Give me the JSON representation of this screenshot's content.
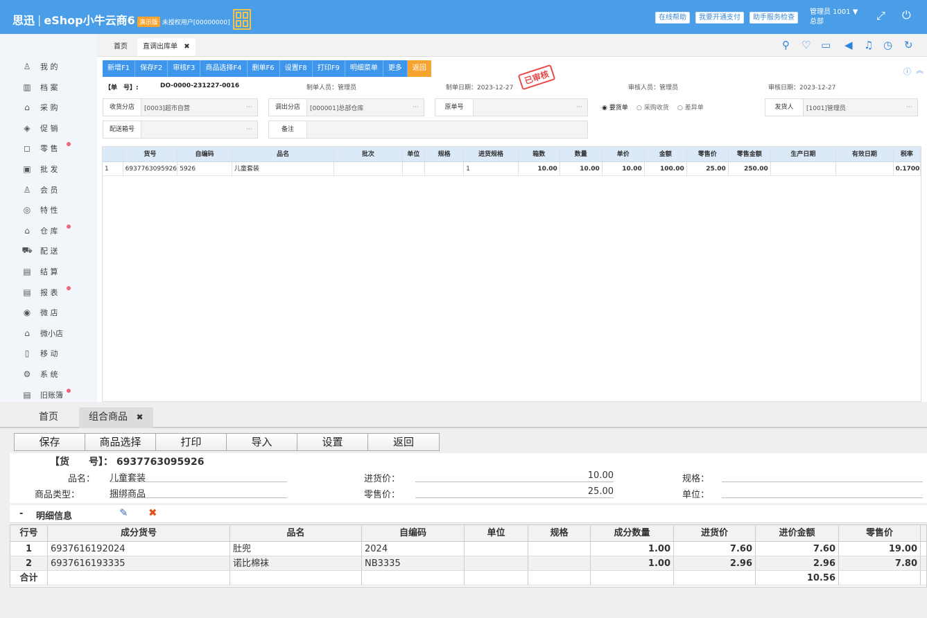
{
  "topbar": {
    "brand_left": "思迅",
    "brand_sep": "|",
    "brand_right": "eShop小牛云商6",
    "demo_badge": "演示版",
    "unauthorized": "未授权用户[00000000]",
    "buttons": [
      "在线帮助",
      "我要开通支付",
      "助手服务检查"
    ],
    "user": "管理员 1001 ▼",
    "org": "总部"
  },
  "sidebar": {
    "items": [
      {
        "label": "我 的",
        "icon": "user-icon",
        "dot": false
      },
      {
        "label": "档 案",
        "icon": "archive-icon",
        "dot": false
      },
      {
        "label": "采 购",
        "icon": "basket-icon",
        "dot": false
      },
      {
        "label": "促 销",
        "icon": "promotion-icon",
        "dot": false
      },
      {
        "label": "零 售",
        "icon": "bag-icon",
        "dot": true
      },
      {
        "label": "批 发",
        "icon": "wholesale-icon",
        "dot": false
      },
      {
        "label": "会 员",
        "icon": "member-icon",
        "dot": false
      },
      {
        "label": "特 性",
        "icon": "feature-icon",
        "dot": false
      },
      {
        "label": "仓 库",
        "icon": "warehouse-icon",
        "dot": true
      },
      {
        "label": "配 送",
        "icon": "truck-icon",
        "dot": false
      },
      {
        "label": "结 算",
        "icon": "settlement-icon",
        "dot": false
      },
      {
        "label": "报 表",
        "icon": "report-icon",
        "dot": true
      },
      {
        "label": "微 店",
        "icon": "micro-store-icon",
        "dot": false
      },
      {
        "label": "微小店",
        "icon": "mini-store-icon",
        "dot": false
      },
      {
        "label": "移 动",
        "icon": "mobile-icon",
        "dot": false
      },
      {
        "label": "系 统",
        "icon": "settings-icon",
        "dot": false
      },
      {
        "label": "旧账簿",
        "icon": "ledger-icon",
        "dot": true
      }
    ]
  },
  "tabs1": {
    "home": "首页",
    "active": "直调出库单",
    "close": "✖"
  },
  "toolbar1": [
    "新增F1",
    "保存F2",
    "审核F3",
    "商品选择F4",
    "删单F6",
    "设置F8",
    "打印F9",
    "明细菜单",
    "更多",
    "返回"
  ],
  "header1": {
    "doc_label": "【单　号】:",
    "doc_no": "DO-0000-231227-0016",
    "maker": "制单人员：管理员",
    "make_date": "制单日期：2023-12-27",
    "stamp": "已审核",
    "auditor": "审核人员：管理员",
    "audit_date": "审核日期：2023-12-27"
  },
  "fields1": {
    "receive_branch_label": "收货分店",
    "receive_branch": "[0003]超市自营",
    "out_branch_label": "调出分店",
    "out_branch": "[000001]总部仓库",
    "orig_no_label": "原单号",
    "orig_no": "",
    "radios": [
      "要货单",
      "采购收货",
      "差异单"
    ],
    "shipper_label": "发货人",
    "shipper": "[1001]管理员",
    "box_label": "配送箱号",
    "box": "",
    "remark_label": "备注",
    "remark": "",
    "more": "···"
  },
  "grid1": {
    "headers": [
      "",
      "货号",
      "自编码",
      "品名",
      "批次",
      "单位",
      "规格",
      "进货规格",
      "箱数",
      "数量",
      "单价",
      "金额",
      "零售价",
      "零售金额",
      "生产日期",
      "有效日期",
      "税率"
    ],
    "rows": [
      [
        "1",
        "6937763095926",
        "5926",
        "儿童套装",
        "",
        "",
        "",
        "1",
        "10.00",
        "10.00",
        "10.00",
        "100.00",
        "25.00",
        "250.00",
        "",
        "",
        "0.1700"
      ]
    ]
  },
  "tabs2": {
    "home": "首页",
    "active": "组合商品",
    "close": "✖"
  },
  "toolbar2": [
    "保存",
    "商品选择",
    "打印",
    "导入",
    "设置",
    "返回"
  ],
  "info2": {
    "doc_label": "【货　　号】：",
    "doc_no": "6937763095926",
    "name_label": "品名：",
    "name": "儿童套装",
    "type_label": "商品类型：",
    "type": "捆绑商品",
    "in_price_label": "进货价：",
    "in_price": "10.00",
    "retail_label": "零售价：",
    "retail": "25.00",
    "spec_label": "规格：",
    "spec": "",
    "unit_label": "单位：",
    "unit": ""
  },
  "detail": {
    "bullet": "-",
    "title": "明细信息"
  },
  "grid2": {
    "headers": [
      "行号",
      "成分货号",
      "品名",
      "自编码",
      "单位",
      "规格",
      "成分数量",
      "进货价",
      "进价金额",
      "零售价"
    ],
    "rows": [
      [
        "1",
        "6937616192024",
        "肚兜",
        "2024",
        "",
        "",
        "1.00",
        "7.60",
        "7.60",
        "19.00"
      ],
      [
        "2",
        "6937616193335",
        "诺比棉袜",
        "NB3335",
        "",
        "",
        "1.00",
        "2.96",
        "2.96",
        "7.80"
      ]
    ],
    "total": [
      "合计",
      "",
      "",
      "",
      "",
      "",
      "",
      "",
      "10.56",
      ""
    ]
  }
}
